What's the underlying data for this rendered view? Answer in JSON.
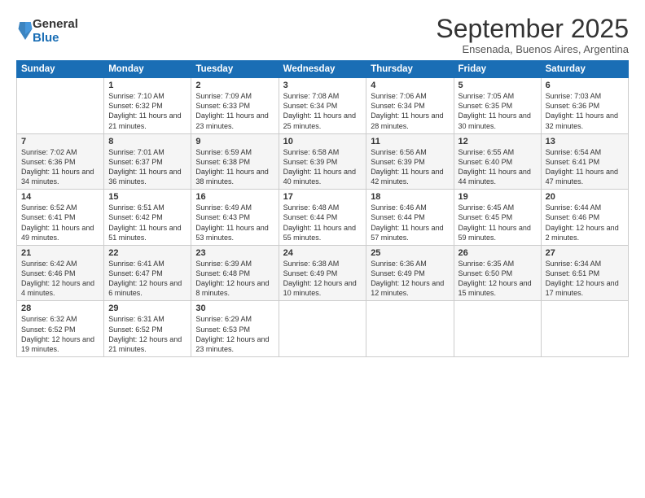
{
  "logo": {
    "general": "General",
    "blue": "Blue"
  },
  "title": "September 2025",
  "subtitle": "Ensenada, Buenos Aires, Argentina",
  "days_of_week": [
    "Sunday",
    "Monday",
    "Tuesday",
    "Wednesday",
    "Thursday",
    "Friday",
    "Saturday"
  ],
  "weeks": [
    [
      {
        "day": "",
        "sunrise": "",
        "sunset": "",
        "daylight": ""
      },
      {
        "day": "1",
        "sunrise": "Sunrise: 7:10 AM",
        "sunset": "Sunset: 6:32 PM",
        "daylight": "Daylight: 11 hours and 21 minutes."
      },
      {
        "day": "2",
        "sunrise": "Sunrise: 7:09 AM",
        "sunset": "Sunset: 6:33 PM",
        "daylight": "Daylight: 11 hours and 23 minutes."
      },
      {
        "day": "3",
        "sunrise": "Sunrise: 7:08 AM",
        "sunset": "Sunset: 6:34 PM",
        "daylight": "Daylight: 11 hours and 25 minutes."
      },
      {
        "day": "4",
        "sunrise": "Sunrise: 7:06 AM",
        "sunset": "Sunset: 6:34 PM",
        "daylight": "Daylight: 11 hours and 28 minutes."
      },
      {
        "day": "5",
        "sunrise": "Sunrise: 7:05 AM",
        "sunset": "Sunset: 6:35 PM",
        "daylight": "Daylight: 11 hours and 30 minutes."
      },
      {
        "day": "6",
        "sunrise": "Sunrise: 7:03 AM",
        "sunset": "Sunset: 6:36 PM",
        "daylight": "Daylight: 11 hours and 32 minutes."
      }
    ],
    [
      {
        "day": "7",
        "sunrise": "Sunrise: 7:02 AM",
        "sunset": "Sunset: 6:36 PM",
        "daylight": "Daylight: 11 hours and 34 minutes."
      },
      {
        "day": "8",
        "sunrise": "Sunrise: 7:01 AM",
        "sunset": "Sunset: 6:37 PM",
        "daylight": "Daylight: 11 hours and 36 minutes."
      },
      {
        "day": "9",
        "sunrise": "Sunrise: 6:59 AM",
        "sunset": "Sunset: 6:38 PM",
        "daylight": "Daylight: 11 hours and 38 minutes."
      },
      {
        "day": "10",
        "sunrise": "Sunrise: 6:58 AM",
        "sunset": "Sunset: 6:39 PM",
        "daylight": "Daylight: 11 hours and 40 minutes."
      },
      {
        "day": "11",
        "sunrise": "Sunrise: 6:56 AM",
        "sunset": "Sunset: 6:39 PM",
        "daylight": "Daylight: 11 hours and 42 minutes."
      },
      {
        "day": "12",
        "sunrise": "Sunrise: 6:55 AM",
        "sunset": "Sunset: 6:40 PM",
        "daylight": "Daylight: 11 hours and 44 minutes."
      },
      {
        "day": "13",
        "sunrise": "Sunrise: 6:54 AM",
        "sunset": "Sunset: 6:41 PM",
        "daylight": "Daylight: 11 hours and 47 minutes."
      }
    ],
    [
      {
        "day": "14",
        "sunrise": "Sunrise: 6:52 AM",
        "sunset": "Sunset: 6:41 PM",
        "daylight": "Daylight: 11 hours and 49 minutes."
      },
      {
        "day": "15",
        "sunrise": "Sunrise: 6:51 AM",
        "sunset": "Sunset: 6:42 PM",
        "daylight": "Daylight: 11 hours and 51 minutes."
      },
      {
        "day": "16",
        "sunrise": "Sunrise: 6:49 AM",
        "sunset": "Sunset: 6:43 PM",
        "daylight": "Daylight: 11 hours and 53 minutes."
      },
      {
        "day": "17",
        "sunrise": "Sunrise: 6:48 AM",
        "sunset": "Sunset: 6:44 PM",
        "daylight": "Daylight: 11 hours and 55 minutes."
      },
      {
        "day": "18",
        "sunrise": "Sunrise: 6:46 AM",
        "sunset": "Sunset: 6:44 PM",
        "daylight": "Daylight: 11 hours and 57 minutes."
      },
      {
        "day": "19",
        "sunrise": "Sunrise: 6:45 AM",
        "sunset": "Sunset: 6:45 PM",
        "daylight": "Daylight: 11 hours and 59 minutes."
      },
      {
        "day": "20",
        "sunrise": "Sunrise: 6:44 AM",
        "sunset": "Sunset: 6:46 PM",
        "daylight": "Daylight: 12 hours and 2 minutes."
      }
    ],
    [
      {
        "day": "21",
        "sunrise": "Sunrise: 6:42 AM",
        "sunset": "Sunset: 6:46 PM",
        "daylight": "Daylight: 12 hours and 4 minutes."
      },
      {
        "day": "22",
        "sunrise": "Sunrise: 6:41 AM",
        "sunset": "Sunset: 6:47 PM",
        "daylight": "Daylight: 12 hours and 6 minutes."
      },
      {
        "day": "23",
        "sunrise": "Sunrise: 6:39 AM",
        "sunset": "Sunset: 6:48 PM",
        "daylight": "Daylight: 12 hours and 8 minutes."
      },
      {
        "day": "24",
        "sunrise": "Sunrise: 6:38 AM",
        "sunset": "Sunset: 6:49 PM",
        "daylight": "Daylight: 12 hours and 10 minutes."
      },
      {
        "day": "25",
        "sunrise": "Sunrise: 6:36 AM",
        "sunset": "Sunset: 6:49 PM",
        "daylight": "Daylight: 12 hours and 12 minutes."
      },
      {
        "day": "26",
        "sunrise": "Sunrise: 6:35 AM",
        "sunset": "Sunset: 6:50 PM",
        "daylight": "Daylight: 12 hours and 15 minutes."
      },
      {
        "day": "27",
        "sunrise": "Sunrise: 6:34 AM",
        "sunset": "Sunset: 6:51 PM",
        "daylight": "Daylight: 12 hours and 17 minutes."
      }
    ],
    [
      {
        "day": "28",
        "sunrise": "Sunrise: 6:32 AM",
        "sunset": "Sunset: 6:52 PM",
        "daylight": "Daylight: 12 hours and 19 minutes."
      },
      {
        "day": "29",
        "sunrise": "Sunrise: 6:31 AM",
        "sunset": "Sunset: 6:52 PM",
        "daylight": "Daylight: 12 hours and 21 minutes."
      },
      {
        "day": "30",
        "sunrise": "Sunrise: 6:29 AM",
        "sunset": "Sunset: 6:53 PM",
        "daylight": "Daylight: 12 hours and 23 minutes."
      },
      {
        "day": "",
        "sunrise": "",
        "sunset": "",
        "daylight": ""
      },
      {
        "day": "",
        "sunrise": "",
        "sunset": "",
        "daylight": ""
      },
      {
        "day": "",
        "sunrise": "",
        "sunset": "",
        "daylight": ""
      },
      {
        "day": "",
        "sunrise": "",
        "sunset": "",
        "daylight": ""
      }
    ]
  ]
}
